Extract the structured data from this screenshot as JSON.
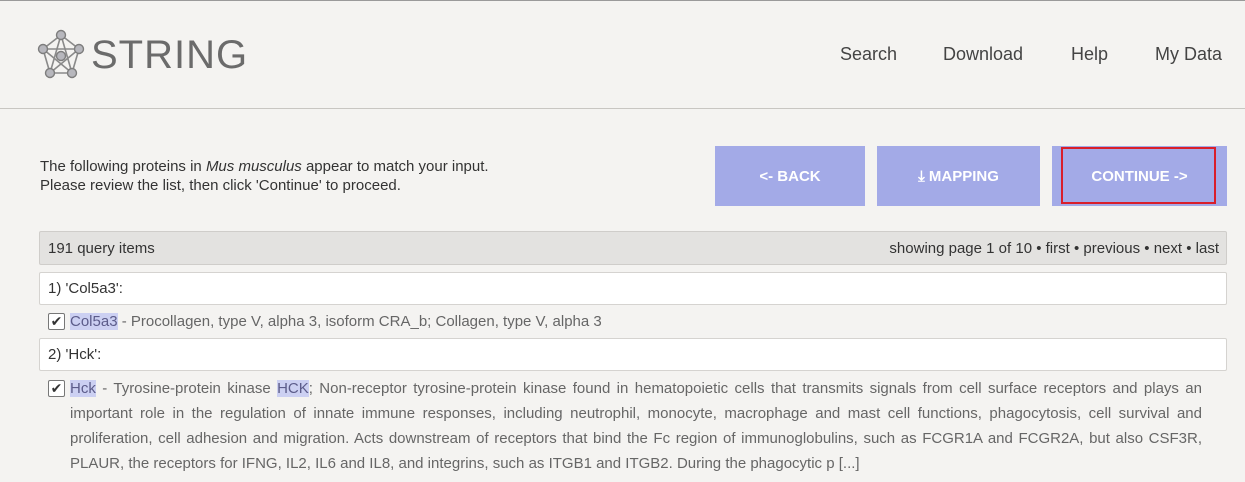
{
  "header": {
    "logo_text": "STRING",
    "nav": [
      "Search",
      "Download",
      "Help",
      "My Data"
    ]
  },
  "intro": {
    "line1_pre": "The following proteins in ",
    "organism": "Mus musculus",
    "line1_post": " appear to match your input.",
    "line2": "Please review the list, then click 'Continue' to proceed."
  },
  "buttons": {
    "back": "<- BACK",
    "mapping": "⤓ MAPPING",
    "continue": "CONTINUE ->"
  },
  "listbar": {
    "count": "191 query items",
    "page_text": "showing page 1 of 10",
    "sep": " • ",
    "first": "first",
    "previous": "previous",
    "next": "next",
    "last": "last"
  },
  "queries": [
    {
      "label": "1) 'Col5a3':",
      "checked": true,
      "name": "Col5a3",
      "desc": " - Procollagen, type V, alpha 3, isoform CRA_b; Collagen, type V, alpha 3"
    },
    {
      "label": "2) 'Hck':",
      "checked": true,
      "name": "Hck",
      "desc_a": " - Tyrosine-protein kinase ",
      "name2": "HCK",
      "desc_b": "; Non-receptor tyrosine-protein kinase found in hematopoietic cells that transmits signals from cell surface receptors and plays an important role in the regulation of innate immune responses, including neutrophil, monocyte, macrophage and mast cell functions, phagocytosis, cell survival and proliferation, cell adhesion and migration. Acts downstream of receptors that bind the Fc region of immunoglobulins, such as FCGR1A and FCGR2A, but also CSF3R, PLAUR, the receptors for IFNG, IL2, IL6 and IL8, and integrins, such as ITGB1 and ITGB2. During the phagocytic p [...]"
    }
  ],
  "colors": {
    "button": "#a3aae7",
    "highlight": "#ccd0f2",
    "focus_box": "#d91e2a"
  }
}
